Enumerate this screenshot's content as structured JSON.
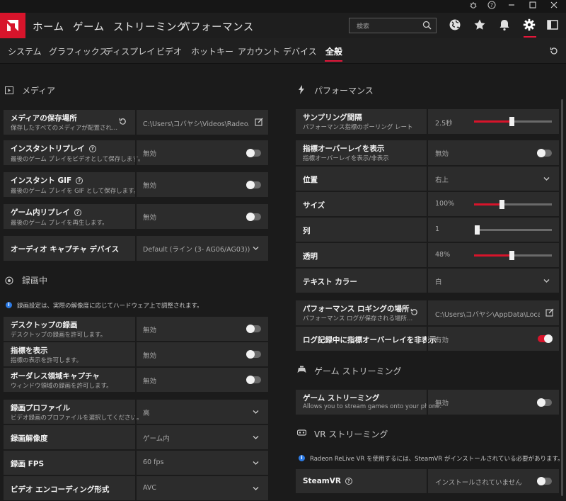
{
  "titlebar": {
    "icons": [
      "bug-icon",
      "help-icon",
      "minimize-icon",
      "maximize-icon",
      "close-icon"
    ],
    "help_glyph": "?"
  },
  "topnav": {
    "items": [
      "ホーム",
      "ゲーム",
      "ストリーミング",
      "パフォーマンス"
    ],
    "search_placeholder": "検索",
    "icons": [
      "globe-icon",
      "star-icon",
      "bell-icon",
      "gear-icon",
      "window-icon"
    ],
    "accent": "#d7142b"
  },
  "subnav": {
    "items": [
      "システム",
      "グラフィックス",
      "ディスプレイ",
      "ビデオ",
      "ホットキー",
      "アカウント",
      "デバイス",
      "全般"
    ],
    "active": "全般"
  },
  "left": {
    "media_section": "メディア",
    "media_rows": [
      {
        "label": "メディアの保存場所",
        "sub": "保存したすべてのメディアが配置され...",
        "value": "C:\\Users\\コバヤシ\\Videos\\Radeo..."
      },
      {
        "label": "インスタントリプレイ",
        "sub": "最後のゲーム プレイをビデオとして保存します。",
        "value": "無効"
      },
      {
        "label": "インスタント GIF",
        "sub": "最後のゲーム プレイを GIF として保存します。",
        "value": "無効"
      },
      {
        "label": "ゲーム内リプレイ",
        "sub": "最後のゲーム プレイを再生します。",
        "value": "無効"
      },
      {
        "label": "オーディオ キャプチャ デバイス",
        "value": "Default (ライン (3- AG06/AG03))"
      }
    ],
    "recording_section": "録画中",
    "recording_note": "録画設定は、実際の解像度に応じてハードウェア上で調整されます。",
    "recording_rows": [
      {
        "label": "デスクトップの録画",
        "sub": "デスクトップの録画を許可します。",
        "value": "無効"
      },
      {
        "label": "指標を表示",
        "sub": "指標の表示を許可します。",
        "value": "無効"
      },
      {
        "label": "ボーダレス領域キャプチャ",
        "sub": "ウィンドウ領域の録画を許可します。",
        "value": "無効"
      },
      {
        "label": "録画プロファイル",
        "sub": "ビデオ録画のプロファイルを選択してください。",
        "value": "高"
      },
      {
        "label": "録画解像度",
        "value": "ゲーム内"
      },
      {
        "label": "録画 FPS",
        "value": "60 fps"
      },
      {
        "label": "ビデオ エンコーディング形式",
        "value": "AVC"
      }
    ]
  },
  "right": {
    "perf_section": "パフォーマンス",
    "sampling": {
      "label": "サンプリング間隔",
      "sub": "パフォーマンス指標のポーリング レート",
      "value": "2.5秒",
      "level": 0.48
    },
    "overlay": {
      "label": "指標オーバーレイを表示",
      "sub": "指標オーバーレイを表示/非表示",
      "value": "無効"
    },
    "position": {
      "label": "位置",
      "value": "右上"
    },
    "size": {
      "label": "サイズ",
      "value": "100%",
      "level": 0.35
    },
    "columns": {
      "label": "列",
      "value": "1",
      "level": 0.0
    },
    "opacity": {
      "label": "透明",
      "value": "48%",
      "level": 0.48
    },
    "text_color": {
      "label": "テキスト カラー",
      "value": "白"
    },
    "log_location": {
      "label": "パフォーマンス ロギングの場所",
      "sub": "パフォーマンス ログが保存される場所...",
      "value": "C:\\Users\\コバヤシ\\AppData\\Local..."
    },
    "hide_overlay": {
      "label": "ログ記録中に指標オーバーレイを非表示",
      "value": "有効"
    },
    "game_streaming_section": "ゲーム ストリーミング",
    "game_streaming": {
      "label": "ゲーム ストリーミング",
      "sub": "Allows you to stream games onto your phone.",
      "value": "無効"
    },
    "vr_section": "VR ストリーミング",
    "vr_note": "Radeon ReLive VR を使用するには、SteamVR がインストールされている必要があります。",
    "steamvr": {
      "label": "SteamVR",
      "value": "インストールされていません"
    }
  }
}
